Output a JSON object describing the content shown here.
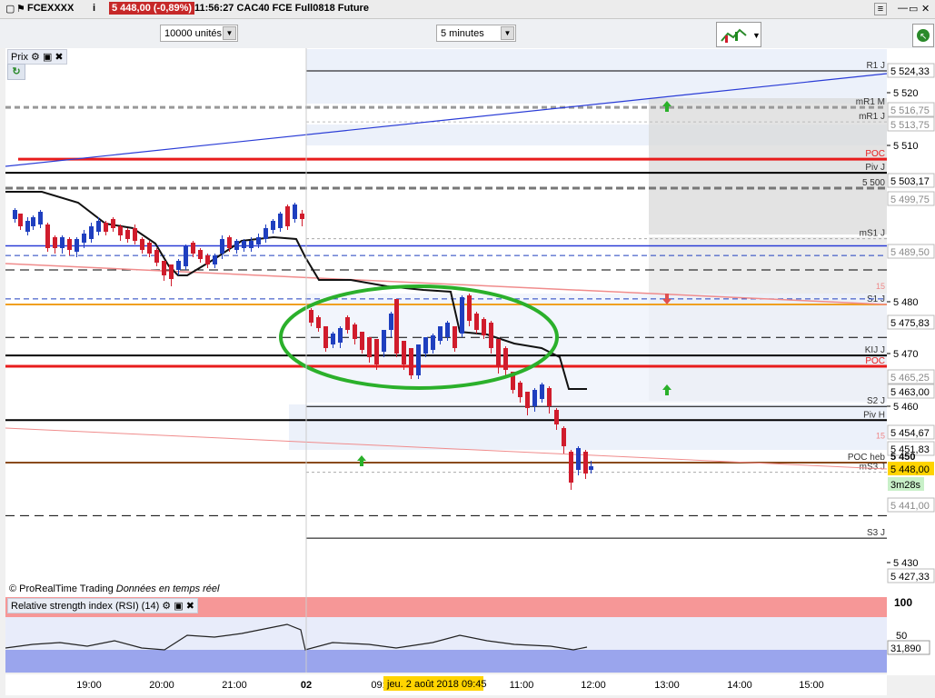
{
  "title_bar": {
    "ticker": "FCEXXXX",
    "price_badge": "5 448,00 (-0,89%)",
    "info": "11:56:27  CAC40 FCE Full0818 Future"
  },
  "toolbar": {
    "units_select": "10000 unités",
    "timeframe_select": "5 minutes"
  },
  "price_panel": {
    "label": "Prix",
    "watermark_brand": "© ProRealTime Trading",
    "watermark_note": "Données en temps réel"
  },
  "rsi_panel": {
    "label": "Relative strength index (RSI) (14)",
    "axis_100": "100",
    "axis_50": "50",
    "value": "31,890"
  },
  "x_axis": {
    "ticks": [
      "19:00",
      "20:00",
      "21:00",
      "02",
      "09:",
      "10:00",
      "11:00",
      "12:00",
      "13:00",
      "14:00",
      "15:00"
    ],
    "cursor_label": "jeu. 2 août 2018 09:45"
  },
  "y_axis": {
    "ticks": [
      "5 520",
      "5 510",
      "5 480",
      "5 470",
      "5 460",
      "5 430"
    ],
    "level_tags": [
      "5 524,33",
      "5 516,75",
      "5 513,75",
      "5 503,17",
      "5 499,75",
      "5 489,50",
      "5 475,83",
      "5 465,25",
      "5 463,00",
      "5 454,67",
      "5 451,83",
      "5 441,00",
      "5 427,33"
    ],
    "current_price": "5 448,00",
    "countdown": "3m28s",
    "partial_tick": "5 450"
  },
  "level_labels": {
    "r1": "R1 J",
    "mr1m": "mR1 M",
    "mr1j": "mR1 J",
    "poc_top": "POC",
    "pivj": "Piv J",
    "five500": "5 500",
    "ms1": "mS1 J",
    "fifteen_a": "15",
    "s1": "S1 J",
    "ms2": "mS2",
    "kij": "KIJ J",
    "poc_mid": "POC",
    "s2": "S2 J",
    "pivh": "Piv H",
    "fifteen_b": "15",
    "pocheb": "POC heb",
    "ms3": "mS3 J",
    "s3": "S3 J",
    "pivm": "Piv M"
  },
  "colors": {
    "up_candle": "#1f3fbf",
    "down_candle": "#d01c2c",
    "poc_line": "#e81c1c",
    "trend_blue": "#2a3cd6",
    "trend_pink": "#f08c8c",
    "ellipse": "#2bb02b",
    "price_badge_bg": "#ffd400"
  },
  "chart_data": {
    "type": "candlestick",
    "ylim": [
      5420,
      5530
    ],
    "levels": [
      {
        "name": "R1 J",
        "value": 5524.33
      },
      {
        "name": "mR1 M",
        "value": 5516.75
      },
      {
        "name": "mR1 J",
        "value": 5513.75
      },
      {
        "name": "POC",
        "value": 5506
      },
      {
        "name": "Piv J",
        "value": 5503.17
      },
      {
        "name": "5 500",
        "value": 5500
      },
      {
        "name": "mS1 J",
        "value": 5489.5
      },
      {
        "name": "S1 J",
        "value": 5475.83
      },
      {
        "name": "KIJ J",
        "value": 5465.25
      },
      {
        "name": "POC",
        "value": 5463
      },
      {
        "name": "S2 J",
        "value": 5454.67
      },
      {
        "name": "Piv H",
        "value": 5451.83
      },
      {
        "name": "POC heb",
        "value": 5443
      },
      {
        "name": "mS3 J",
        "value": 5441
      },
      {
        "name": "S3 J",
        "value": 5427.33
      }
    ],
    "last_price": 5448,
    "rsi_last": 31.89
  }
}
